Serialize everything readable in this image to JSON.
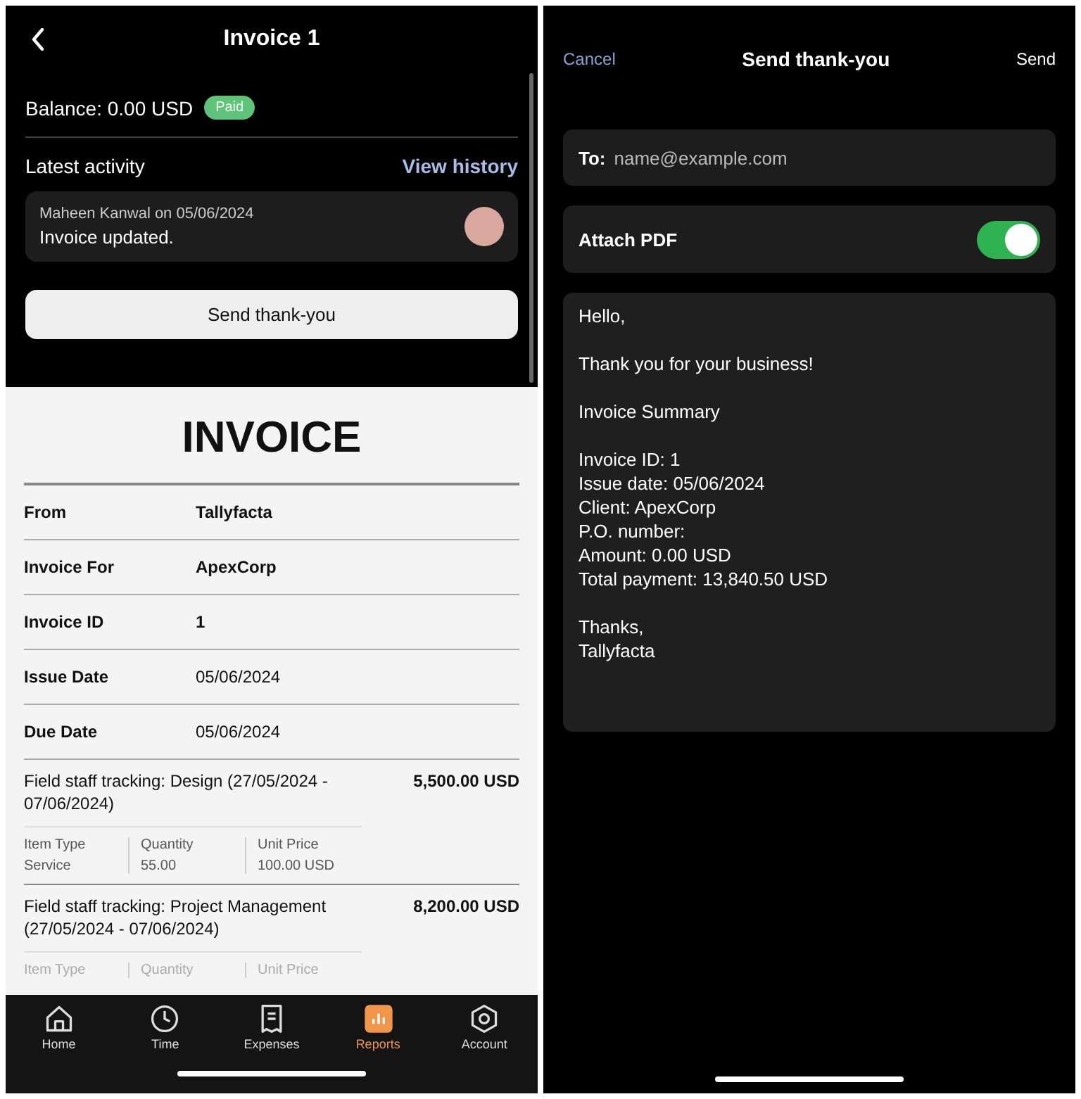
{
  "invoice_screen": {
    "title": "Invoice 1",
    "balance": "Balance: 0.00 USD",
    "status_badge": "Paid",
    "activity_heading": "Latest activity",
    "view_history": "View history",
    "activity": {
      "author_date": "Maheen Kanwal on 05/06/2024",
      "message": "Invoice updated."
    },
    "send_button": "Send thank-you",
    "document": {
      "heading": "INVOICE",
      "fields": [
        {
          "label": "From",
          "value": "Tallyfacta",
          "value_bold": true
        },
        {
          "label": "Invoice For",
          "value": "ApexCorp",
          "value_bold": true
        },
        {
          "label": "Invoice ID",
          "value": "1",
          "value_bold": true
        },
        {
          "label": "Issue Date",
          "value": "05/06/2024",
          "value_bold": false
        },
        {
          "label": "Due Date",
          "value": "05/06/2024",
          "value_bold": false
        }
      ],
      "line_items": [
        {
          "description": "Field staff tracking: Design (27/05/2024 - 07/06/2024)",
          "amount": "5,500.00 USD",
          "details": [
            {
              "label": "Item Type",
              "value": "Service"
            },
            {
              "label": "Quantity",
              "value": "55.00"
            },
            {
              "label": "Unit Price",
              "value": "100.00 USD"
            }
          ]
        },
        {
          "description": "Field staff tracking: Project Management (27/05/2024 - 07/06/2024)",
          "amount": "8,200.00 USD",
          "details": [
            {
              "label": "Item Type"
            },
            {
              "label": "Quantity"
            },
            {
              "label": "Unit Price"
            }
          ]
        }
      ]
    },
    "tab_bar": [
      {
        "kind": "home",
        "label": "Home",
        "selected": false
      },
      {
        "kind": "time",
        "label": "Time",
        "selected": false
      },
      {
        "kind": "expenses",
        "label": "Expenses",
        "selected": false
      },
      {
        "kind": "reports",
        "label": "Reports",
        "selected": true
      },
      {
        "kind": "account",
        "label": "Account",
        "selected": false
      }
    ]
  },
  "compose_screen": {
    "cancel": "Cancel",
    "title": "Send thank-you",
    "send": "Send",
    "to_label": "To:",
    "to_placeholder": "name@example.com",
    "attach_label": "Attach PDF",
    "attach_on": true,
    "body": [
      [
        "Hello,"
      ],
      [
        "Thank you for your business!"
      ],
      [
        "Invoice Summary"
      ],
      [
        "Invoice ID: 1",
        "Issue date: 05/06/2024",
        "Client: ApexCorp",
        "P.O. number:",
        "Amount: 0.00 USD",
        "Total payment: 13,840.50 USD"
      ],
      [
        "Thanks,",
        "Tallyfacta"
      ]
    ]
  }
}
